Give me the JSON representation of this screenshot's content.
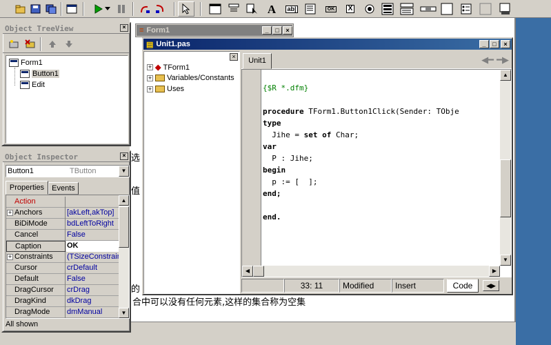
{
  "toolbar": {
    "icons": [
      "open-icon",
      "save-icon",
      "save-all-icon",
      "toggle-form-icon",
      "run-icon",
      "dropdown-icon",
      "pause-icon",
      "step-over-icon",
      "trace-into-icon",
      "pointer-icon",
      "frame-icon",
      "mainmenu-icon",
      "popupmenu-icon",
      "label-icon",
      "edit-icon",
      "memo-icon",
      "button-icon",
      "checkbox-icon",
      "radiobutton-icon",
      "listbox-icon",
      "combobox-icon",
      "scrollbar-icon",
      "groupbox-icon",
      "radiogroup-icon",
      "panel-icon",
      "actionlist-icon"
    ],
    "label_A": "A",
    "edit_label": "ab|",
    "ok_label": "OK",
    "x_label": "X"
  },
  "treeview": {
    "title": "Object TreeView",
    "items": [
      {
        "label": "Form1"
      },
      {
        "label": "Button1"
      },
      {
        "label": "Edit"
      }
    ]
  },
  "inspector": {
    "title": "Object Inspector",
    "selected_object": "Button1",
    "selected_type": "TButton",
    "tabs": [
      {
        "label": "Properties"
      },
      {
        "label": "Events"
      }
    ],
    "properties": [
      {
        "name": "Action",
        "value": ""
      },
      {
        "name": "Anchors",
        "value": "[akLeft,akTop]"
      },
      {
        "name": "BiDiMode",
        "value": "bdLeftToRight"
      },
      {
        "name": "Cancel",
        "value": "False"
      },
      {
        "name": "Caption",
        "value": "OK"
      },
      {
        "name": "Constraints",
        "value": "(TSizeConstraint"
      },
      {
        "name": "Cursor",
        "value": "crDefault"
      },
      {
        "name": "Default",
        "value": "False"
      },
      {
        "name": "DragCursor",
        "value": "crDrag"
      },
      {
        "name": "DragKind",
        "value": "dkDrag"
      },
      {
        "name": "DragMode",
        "value": "dmManual"
      }
    ],
    "status": "All shown"
  },
  "form1": {
    "title": "Form1"
  },
  "unit": {
    "title": "Unit1.pas",
    "tab": "Unit1",
    "explorer": [
      {
        "label": "TForm1"
      },
      {
        "label": "Variables/Constants"
      },
      {
        "label": "Uses"
      }
    ],
    "code": [
      {
        "text": "{$R *.dfm}"
      },
      {
        "text": ""
      },
      {
        "kw": "procedure",
        "text": " TForm1.Button1Click(Sender: TObje"
      },
      {
        "kw": "type",
        "text": ""
      },
      {
        "pre": "  Jihe = ",
        "kw": "set of",
        "text": " Char;"
      },
      {
        "kw": "var",
        "text": ""
      },
      {
        "text": "  P : Jihe;"
      },
      {
        "kw": "begin",
        "text": ""
      },
      {
        "text": "  p := [  ];"
      },
      {
        "kw": "end;",
        "text": ""
      },
      {
        "text": ""
      },
      {
        "kw": "end.",
        "text": ""
      }
    ],
    "status": {
      "pos": "33: 11",
      "state": "Modified",
      "mode": "Insert",
      "view_tab": "Code"
    }
  },
  "document": {
    "line_bottom": "合中可以没有任何元素,这样的集合称为空集",
    "fragment1": "选",
    "fragment2": "值",
    "fragment3": "的"
  },
  "colors": {
    "titlebar_active": "#0a246a",
    "property_value": "#0000a0",
    "action_red": "#c00000",
    "desktop": "#3a6ea5"
  }
}
